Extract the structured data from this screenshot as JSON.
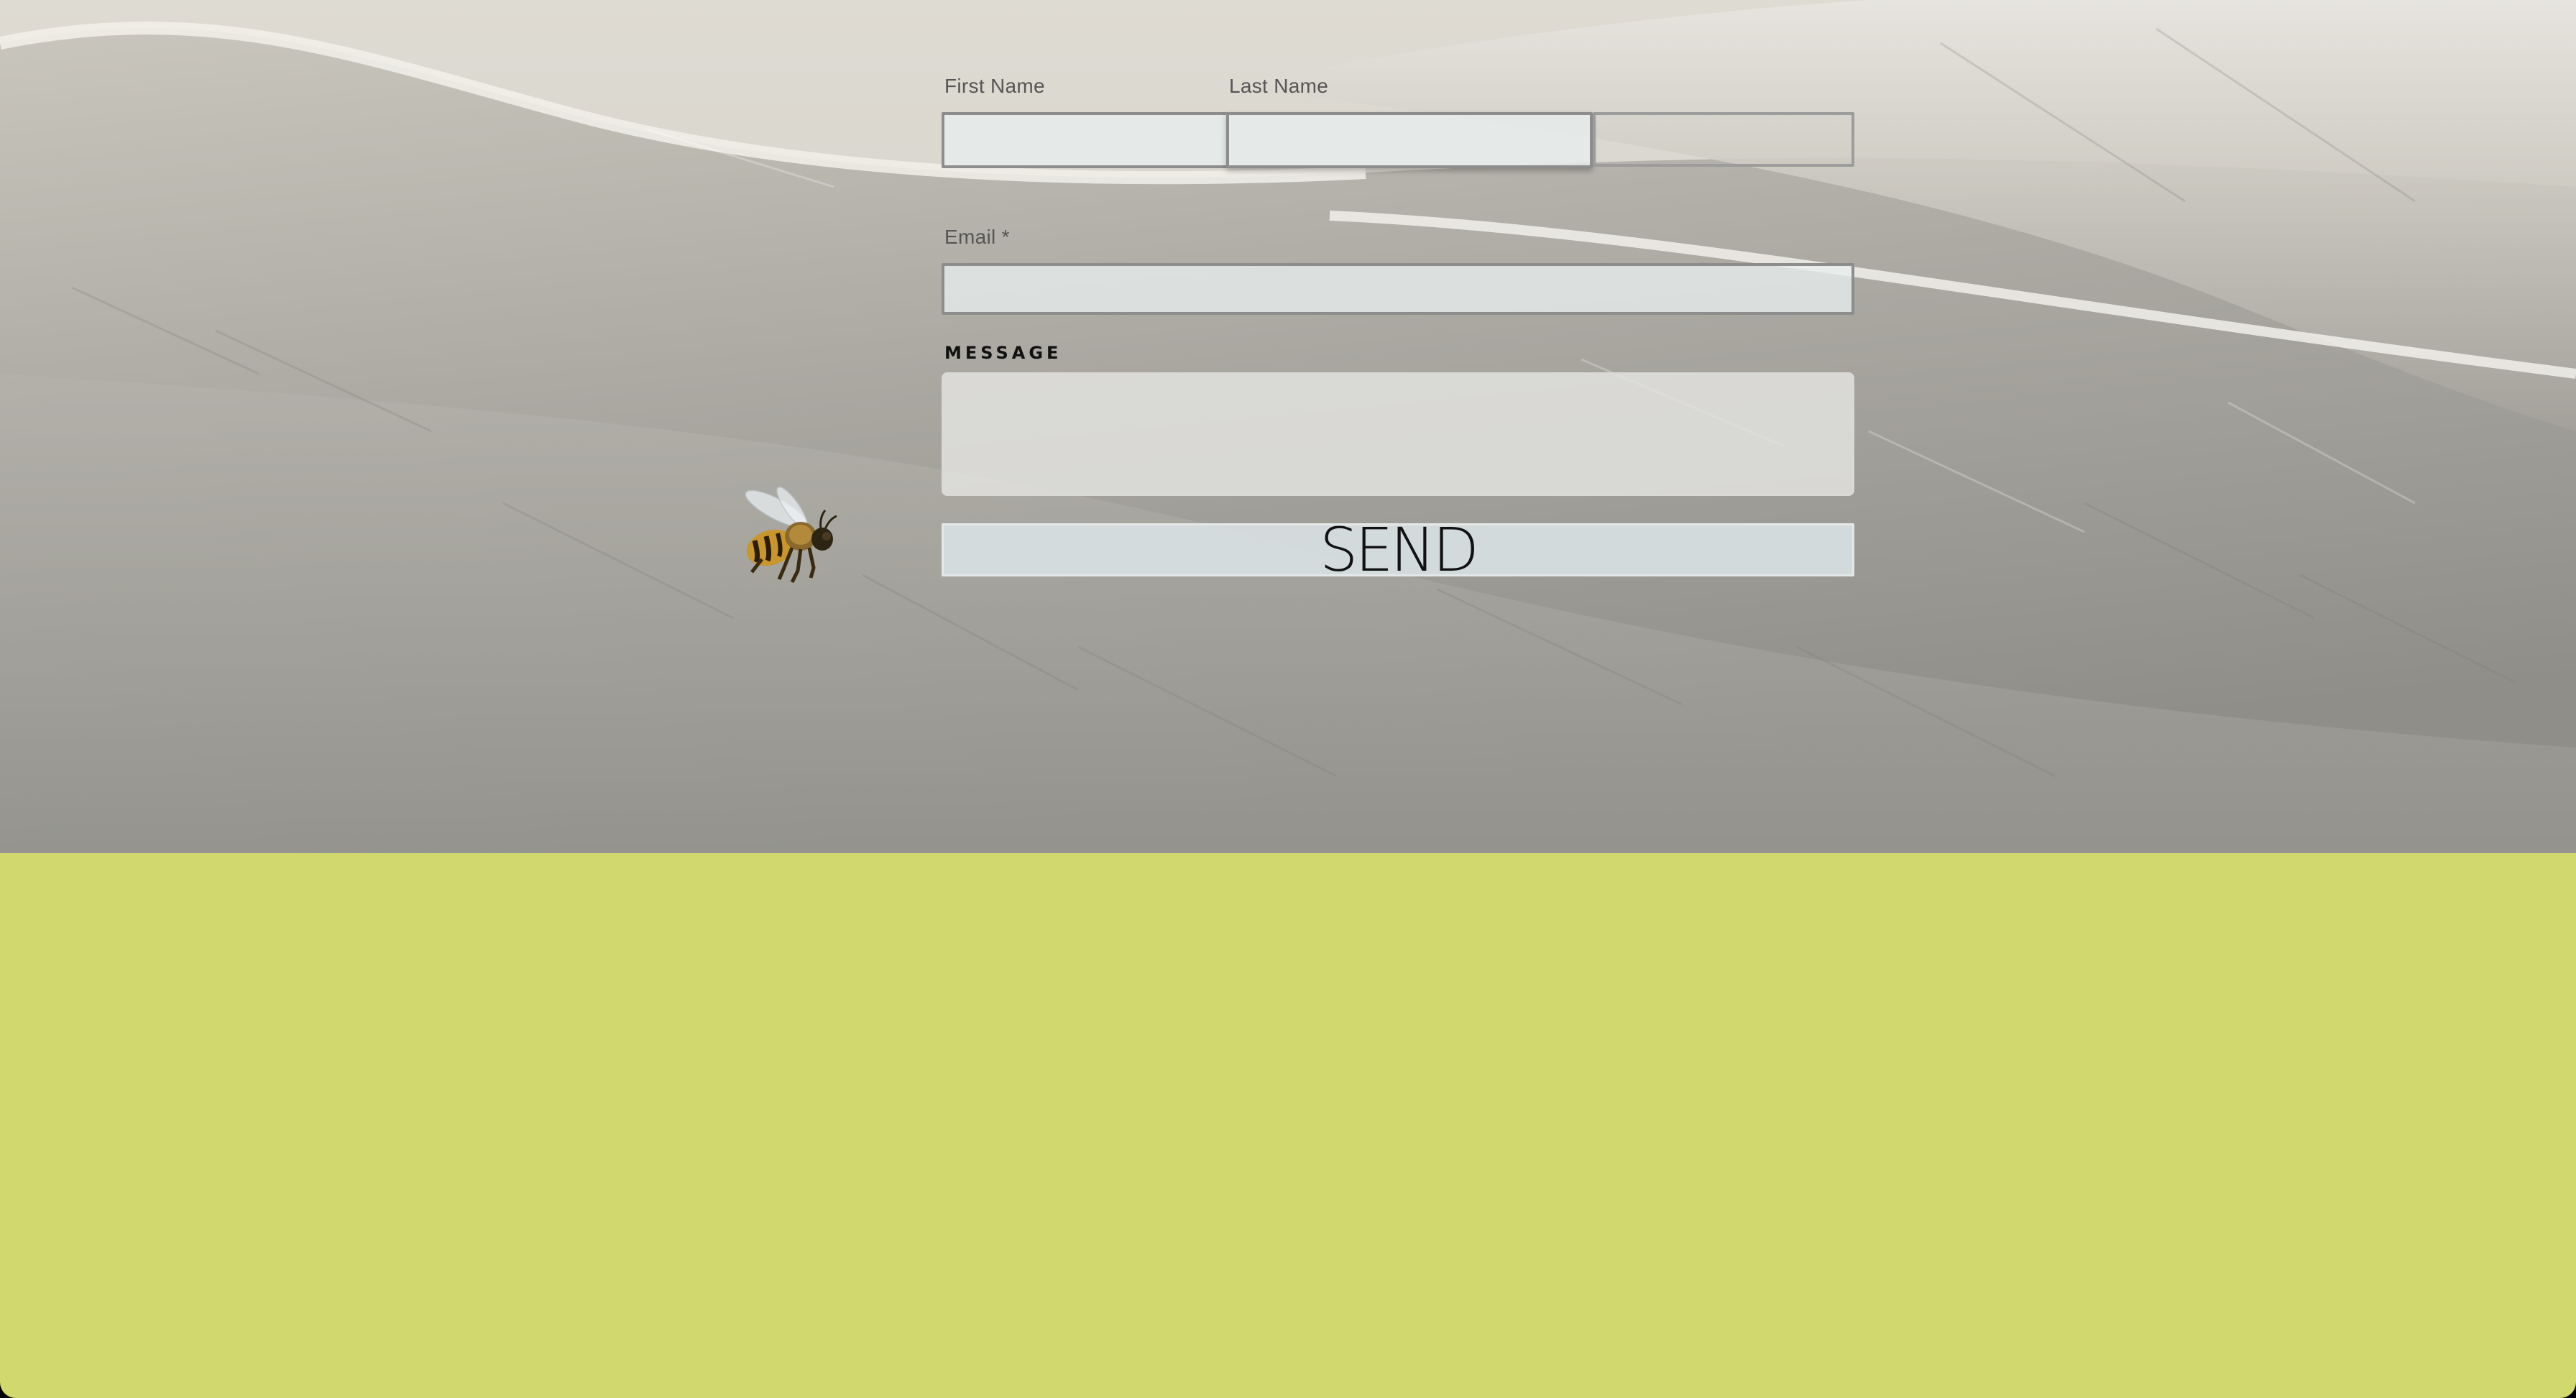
{
  "form": {
    "first_name_label": "First Name",
    "last_name_label": "Last Name",
    "email_label": "Email *",
    "message_label": "MESSAGE",
    "first_name_value": "",
    "last_name_value": "",
    "extra_value": "",
    "email_value": "",
    "message_value": "",
    "send_label": "SEND"
  },
  "colors": {
    "footer_band": "#d1d86d",
    "field_fill": "#e8eeee",
    "field_border": "#8d8d8d"
  },
  "icons": {
    "bee": "bee-icon"
  }
}
